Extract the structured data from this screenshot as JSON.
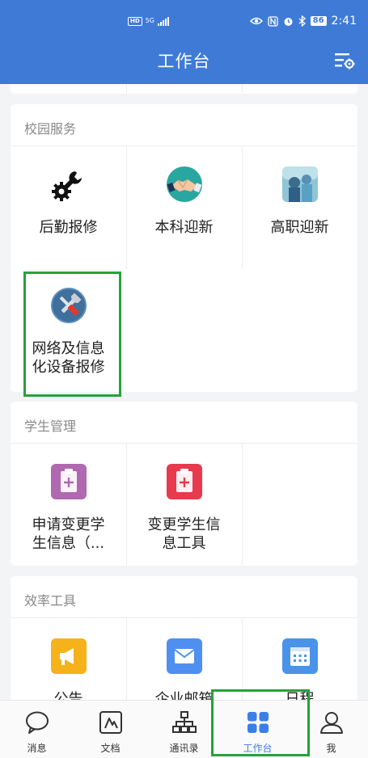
{
  "status_bar": {
    "network": "HD",
    "signal": "5G",
    "battery": "86",
    "time": "2:41"
  },
  "header": {
    "title": "工作台",
    "menu_icon": "settings-list-icon"
  },
  "sections": [
    {
      "title": "校园服务",
      "items": [
        {
          "label": "后勤报修",
          "icon": "wrench-gear-icon"
        },
        {
          "label": "本科迎新",
          "icon": "handshake-icon"
        },
        {
          "label": "高职迎新",
          "icon": "campus-photo-icon"
        },
        {
          "label_line1": "网络及信息",
          "label_line2": "化设备报修",
          "icon": "tools-icon"
        }
      ]
    },
    {
      "title": "学生管理",
      "items": [
        {
          "label_line1": "申请变更学",
          "label_line2": "生信息（...",
          "icon": "clipboard-plus-purple-icon"
        },
        {
          "label_line1": "变更学生信",
          "label_line2": "息工具",
          "icon": "clipboard-plus-red-icon"
        }
      ]
    },
    {
      "title": "效率工具",
      "items": [
        {
          "label": "公告",
          "icon": "megaphone-icon"
        },
        {
          "label": "企业邮箱",
          "icon": "mail-icon"
        },
        {
          "label": "日程",
          "icon": "calendar-icon"
        }
      ]
    }
  ],
  "tabs": [
    {
      "label": "消息",
      "icon": "message-icon"
    },
    {
      "label": "文档",
      "icon": "document-icon"
    },
    {
      "label": "通讯录",
      "icon": "contacts-icon"
    },
    {
      "label": "工作台",
      "icon": "workbench-icon",
      "active": true
    },
    {
      "label": "我",
      "icon": "profile-icon"
    }
  ],
  "colors": {
    "header_bg": "#3f7bd6",
    "highlight": "#25a23a",
    "active_tab": "#3b7ee8"
  }
}
